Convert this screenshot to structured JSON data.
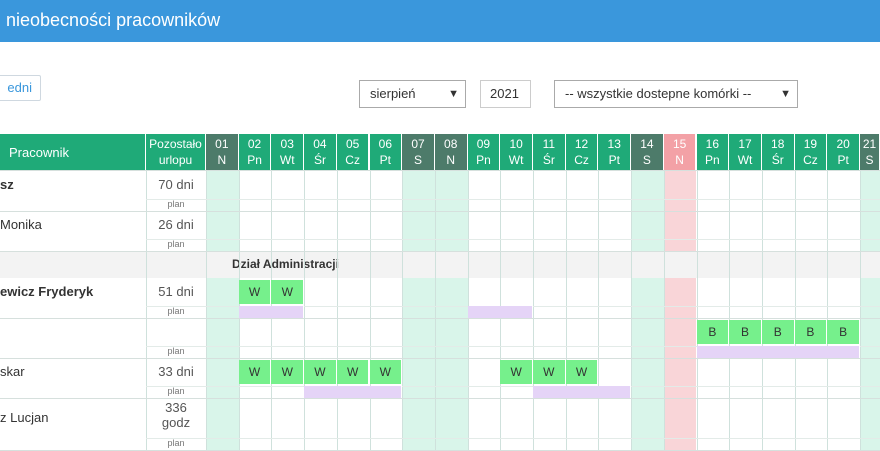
{
  "header": {
    "title": "nieobecności pracowników"
  },
  "toolbar": {
    "prev_label": "edni",
    "month": "sierpień",
    "year": "2021",
    "units": "-- wszystkie dostepne komórki --"
  },
  "colors": {
    "header_green": "#1faa78",
    "weekend_header": "#4d7b6a",
    "holiday_header": "#f3a1a6",
    "absence": "#76f08c",
    "plan": "#e5d4f7"
  },
  "table": {
    "col_employee": "Pracownik",
    "col_remaining_1": "Pozostało",
    "col_remaining_2": "urlopu",
    "plan_label": "plan",
    "days": [
      {
        "d": "01",
        "w": "N",
        "type": "weekend"
      },
      {
        "d": "02",
        "w": "Pn",
        "type": "work"
      },
      {
        "d": "03",
        "w": "Wt",
        "type": "work"
      },
      {
        "d": "04",
        "w": "Śr",
        "type": "work"
      },
      {
        "d": "05",
        "w": "Cz",
        "type": "work"
      },
      {
        "d": "06",
        "w": "Pt",
        "type": "work"
      },
      {
        "d": "07",
        "w": "S",
        "type": "weekend"
      },
      {
        "d": "08",
        "w": "N",
        "type": "weekend"
      },
      {
        "d": "09",
        "w": "Pn",
        "type": "work"
      },
      {
        "d": "10",
        "w": "Wt",
        "type": "work"
      },
      {
        "d": "11",
        "w": "Śr",
        "type": "work"
      },
      {
        "d": "12",
        "w": "Cz",
        "type": "work"
      },
      {
        "d": "13",
        "w": "Pt",
        "type": "work"
      },
      {
        "d": "14",
        "w": "S",
        "type": "weekend"
      },
      {
        "d": "15",
        "w": "N",
        "type": "holiday"
      },
      {
        "d": "16",
        "w": "Pn",
        "type": "work"
      },
      {
        "d": "17",
        "w": "Wt",
        "type": "work"
      },
      {
        "d": "18",
        "w": "Śr",
        "type": "work"
      },
      {
        "d": "19",
        "w": "Cz",
        "type": "work"
      },
      {
        "d": "20",
        "w": "Pt",
        "type": "work"
      },
      {
        "d": "21",
        "w": "S",
        "type": "weekend"
      }
    ],
    "section_title": "Dział Administracji",
    "rows": [
      {
        "name": "sz",
        "remaining": "70 dni",
        "bold": true,
        "absences": [],
        "plans": []
      },
      {
        "name": "Monika",
        "remaining": "26 dni",
        "bold": false,
        "absences": [],
        "plans": []
      },
      {
        "name": "ewicz Fryderyk",
        "remaining": "51 dni",
        "bold": true,
        "absences": [
          {
            "day": 2,
            "code": "W"
          },
          {
            "day": 3,
            "code": "W"
          }
        ],
        "plans": [
          {
            "from": 2,
            "to": 3
          },
          {
            "from": 9,
            "to": 10
          }
        ]
      },
      {
        "name": "",
        "remaining": "",
        "bold": false,
        "absences": [
          {
            "day": 16,
            "code": "B"
          },
          {
            "day": 17,
            "code": "B"
          },
          {
            "day": 18,
            "code": "B"
          },
          {
            "day": 19,
            "code": "B"
          },
          {
            "day": 20,
            "code": "B"
          }
        ],
        "plans": [
          {
            "from": 16,
            "to": 20
          }
        ]
      },
      {
        "name": "skar",
        "remaining": "33 dni",
        "bold": false,
        "absences": [
          {
            "day": 2,
            "code": "W"
          },
          {
            "day": 3,
            "code": "W"
          },
          {
            "day": 4,
            "code": "W"
          },
          {
            "day": 5,
            "code": "W"
          },
          {
            "day": 6,
            "code": "W"
          },
          {
            "day": 10,
            "code": "W"
          },
          {
            "day": 11,
            "code": "W"
          },
          {
            "day": 12,
            "code": "W"
          }
        ],
        "plans": [
          {
            "from": 4,
            "to": 6
          },
          {
            "from": 11,
            "to": 13
          }
        ]
      },
      {
        "name": "z Lucjan",
        "remaining": "336 godz",
        "bold": false,
        "absences": [],
        "plans": []
      }
    ]
  }
}
